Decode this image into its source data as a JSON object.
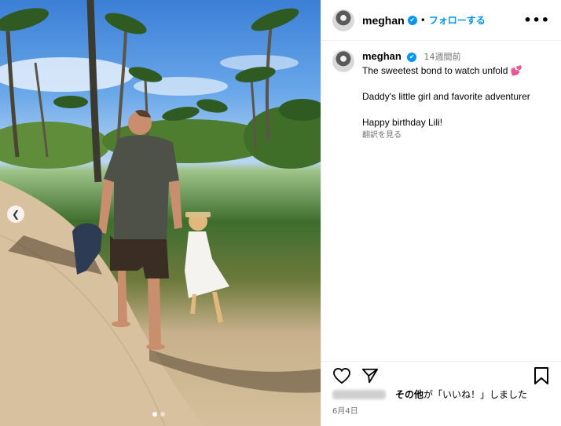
{
  "post": {
    "username": "meghan",
    "follow_label": "フォローする",
    "separator": "•",
    "more_label": "•••",
    "caption": {
      "timestamp": "14週間前",
      "line1": "The sweetest bond to watch unfold",
      "line1_emoji": "💕",
      "line2": "Daddy's little girl and favorite adventurer",
      "line3": "Happy birthday Lili!",
      "translate_label": "翻訳を見る"
    },
    "likes_text_bold": "その他",
    "likes_text_rest": "が「いいね！」しました",
    "date": "6月4日"
  },
  "icons": {
    "verified": "verified-badge-icon",
    "like": "heart-icon",
    "share": "paper-plane-icon",
    "save": "bookmark-icon",
    "prev": "chevron-left-icon"
  },
  "colors": {
    "accent": "#0095f6",
    "muted": "#737373",
    "divider": "#efefef"
  }
}
